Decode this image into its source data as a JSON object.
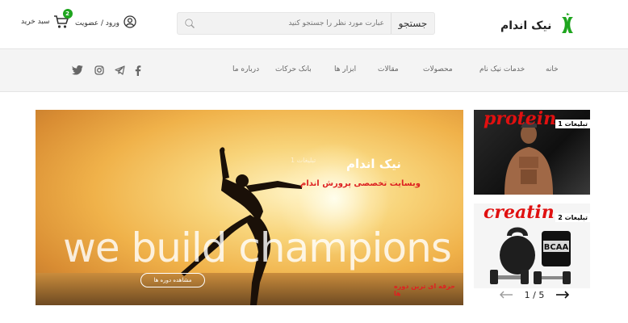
{
  "header": {
    "brand_name": "نیک اندام",
    "search_button": "جستجو",
    "search_placeholder": "عبارت مورد نظر را جستجو کنید",
    "account_label": "ورود / عضویت",
    "cart_label": "سبد خرید",
    "cart_count": "2"
  },
  "nav": {
    "items": [
      "خانه",
      "خدمات نیک نام",
      "محصولات",
      "مقالات",
      "ابزار ها",
      "بانک حرکات",
      "درباره ما"
    ],
    "social": [
      "facebook-icon",
      "telegram-icon",
      "instagram-icon",
      "twitter-icon"
    ]
  },
  "hero": {
    "title": "نیک اندام",
    "subtitle": "وبسایت تخصصی پرورش اندام",
    "watermark": "تبلیغات 1",
    "big_text": "we build champions",
    "button_label": "مشاهده دوره ها",
    "tag": "حرفه ای ترین دوره ها"
  },
  "ads": [
    {
      "word": "protein",
      "label": "تبلیغات 1"
    },
    {
      "word": "creatin",
      "label": "تبلیغات 2"
    }
  ],
  "pager": {
    "current": "1",
    "total": "5",
    "separator": "/"
  },
  "colors": {
    "accent_green": "#1ea51e",
    "ad_red": "#e01010",
    "nav_bg": "#f4f4f4"
  }
}
